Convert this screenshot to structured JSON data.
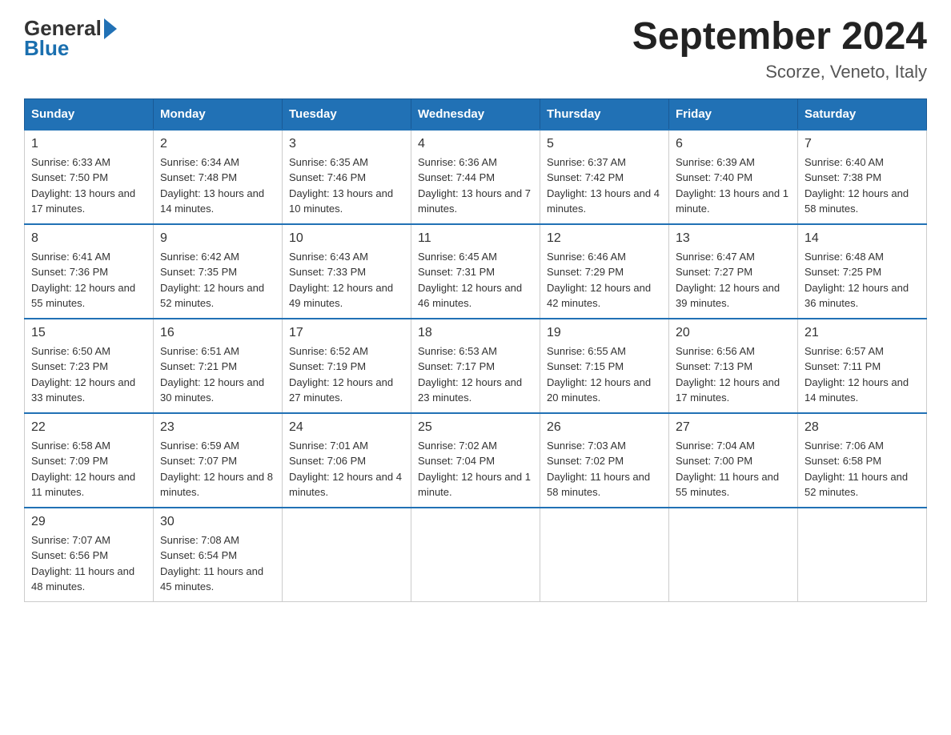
{
  "header": {
    "logo_general": "General",
    "logo_blue": "Blue",
    "title": "September 2024",
    "location": "Scorze, Veneto, Italy"
  },
  "columns": [
    "Sunday",
    "Monday",
    "Tuesday",
    "Wednesday",
    "Thursday",
    "Friday",
    "Saturday"
  ],
  "weeks": [
    [
      {
        "day": "1",
        "sunrise": "Sunrise: 6:33 AM",
        "sunset": "Sunset: 7:50 PM",
        "daylight": "Daylight: 13 hours and 17 minutes."
      },
      {
        "day": "2",
        "sunrise": "Sunrise: 6:34 AM",
        "sunset": "Sunset: 7:48 PM",
        "daylight": "Daylight: 13 hours and 14 minutes."
      },
      {
        "day": "3",
        "sunrise": "Sunrise: 6:35 AM",
        "sunset": "Sunset: 7:46 PM",
        "daylight": "Daylight: 13 hours and 10 minutes."
      },
      {
        "day": "4",
        "sunrise": "Sunrise: 6:36 AM",
        "sunset": "Sunset: 7:44 PM",
        "daylight": "Daylight: 13 hours and 7 minutes."
      },
      {
        "day": "5",
        "sunrise": "Sunrise: 6:37 AM",
        "sunset": "Sunset: 7:42 PM",
        "daylight": "Daylight: 13 hours and 4 minutes."
      },
      {
        "day": "6",
        "sunrise": "Sunrise: 6:39 AM",
        "sunset": "Sunset: 7:40 PM",
        "daylight": "Daylight: 13 hours and 1 minute."
      },
      {
        "day": "7",
        "sunrise": "Sunrise: 6:40 AM",
        "sunset": "Sunset: 7:38 PM",
        "daylight": "Daylight: 12 hours and 58 minutes."
      }
    ],
    [
      {
        "day": "8",
        "sunrise": "Sunrise: 6:41 AM",
        "sunset": "Sunset: 7:36 PM",
        "daylight": "Daylight: 12 hours and 55 minutes."
      },
      {
        "day": "9",
        "sunrise": "Sunrise: 6:42 AM",
        "sunset": "Sunset: 7:35 PM",
        "daylight": "Daylight: 12 hours and 52 minutes."
      },
      {
        "day": "10",
        "sunrise": "Sunrise: 6:43 AM",
        "sunset": "Sunset: 7:33 PM",
        "daylight": "Daylight: 12 hours and 49 minutes."
      },
      {
        "day": "11",
        "sunrise": "Sunrise: 6:45 AM",
        "sunset": "Sunset: 7:31 PM",
        "daylight": "Daylight: 12 hours and 46 minutes."
      },
      {
        "day": "12",
        "sunrise": "Sunrise: 6:46 AM",
        "sunset": "Sunset: 7:29 PM",
        "daylight": "Daylight: 12 hours and 42 minutes."
      },
      {
        "day": "13",
        "sunrise": "Sunrise: 6:47 AM",
        "sunset": "Sunset: 7:27 PM",
        "daylight": "Daylight: 12 hours and 39 minutes."
      },
      {
        "day": "14",
        "sunrise": "Sunrise: 6:48 AM",
        "sunset": "Sunset: 7:25 PM",
        "daylight": "Daylight: 12 hours and 36 minutes."
      }
    ],
    [
      {
        "day": "15",
        "sunrise": "Sunrise: 6:50 AM",
        "sunset": "Sunset: 7:23 PM",
        "daylight": "Daylight: 12 hours and 33 minutes."
      },
      {
        "day": "16",
        "sunrise": "Sunrise: 6:51 AM",
        "sunset": "Sunset: 7:21 PM",
        "daylight": "Daylight: 12 hours and 30 minutes."
      },
      {
        "day": "17",
        "sunrise": "Sunrise: 6:52 AM",
        "sunset": "Sunset: 7:19 PM",
        "daylight": "Daylight: 12 hours and 27 minutes."
      },
      {
        "day": "18",
        "sunrise": "Sunrise: 6:53 AM",
        "sunset": "Sunset: 7:17 PM",
        "daylight": "Daylight: 12 hours and 23 minutes."
      },
      {
        "day": "19",
        "sunrise": "Sunrise: 6:55 AM",
        "sunset": "Sunset: 7:15 PM",
        "daylight": "Daylight: 12 hours and 20 minutes."
      },
      {
        "day": "20",
        "sunrise": "Sunrise: 6:56 AM",
        "sunset": "Sunset: 7:13 PM",
        "daylight": "Daylight: 12 hours and 17 minutes."
      },
      {
        "day": "21",
        "sunrise": "Sunrise: 6:57 AM",
        "sunset": "Sunset: 7:11 PM",
        "daylight": "Daylight: 12 hours and 14 minutes."
      }
    ],
    [
      {
        "day": "22",
        "sunrise": "Sunrise: 6:58 AM",
        "sunset": "Sunset: 7:09 PM",
        "daylight": "Daylight: 12 hours and 11 minutes."
      },
      {
        "day": "23",
        "sunrise": "Sunrise: 6:59 AM",
        "sunset": "Sunset: 7:07 PM",
        "daylight": "Daylight: 12 hours and 8 minutes."
      },
      {
        "day": "24",
        "sunrise": "Sunrise: 7:01 AM",
        "sunset": "Sunset: 7:06 PM",
        "daylight": "Daylight: 12 hours and 4 minutes."
      },
      {
        "day": "25",
        "sunrise": "Sunrise: 7:02 AM",
        "sunset": "Sunset: 7:04 PM",
        "daylight": "Daylight: 12 hours and 1 minute."
      },
      {
        "day": "26",
        "sunrise": "Sunrise: 7:03 AM",
        "sunset": "Sunset: 7:02 PM",
        "daylight": "Daylight: 11 hours and 58 minutes."
      },
      {
        "day": "27",
        "sunrise": "Sunrise: 7:04 AM",
        "sunset": "Sunset: 7:00 PM",
        "daylight": "Daylight: 11 hours and 55 minutes."
      },
      {
        "day": "28",
        "sunrise": "Sunrise: 7:06 AM",
        "sunset": "Sunset: 6:58 PM",
        "daylight": "Daylight: 11 hours and 52 minutes."
      }
    ],
    [
      {
        "day": "29",
        "sunrise": "Sunrise: 7:07 AM",
        "sunset": "Sunset: 6:56 PM",
        "daylight": "Daylight: 11 hours and 48 minutes."
      },
      {
        "day": "30",
        "sunrise": "Sunrise: 7:08 AM",
        "sunset": "Sunset: 6:54 PM",
        "daylight": "Daylight: 11 hours and 45 minutes."
      },
      null,
      null,
      null,
      null,
      null
    ]
  ]
}
